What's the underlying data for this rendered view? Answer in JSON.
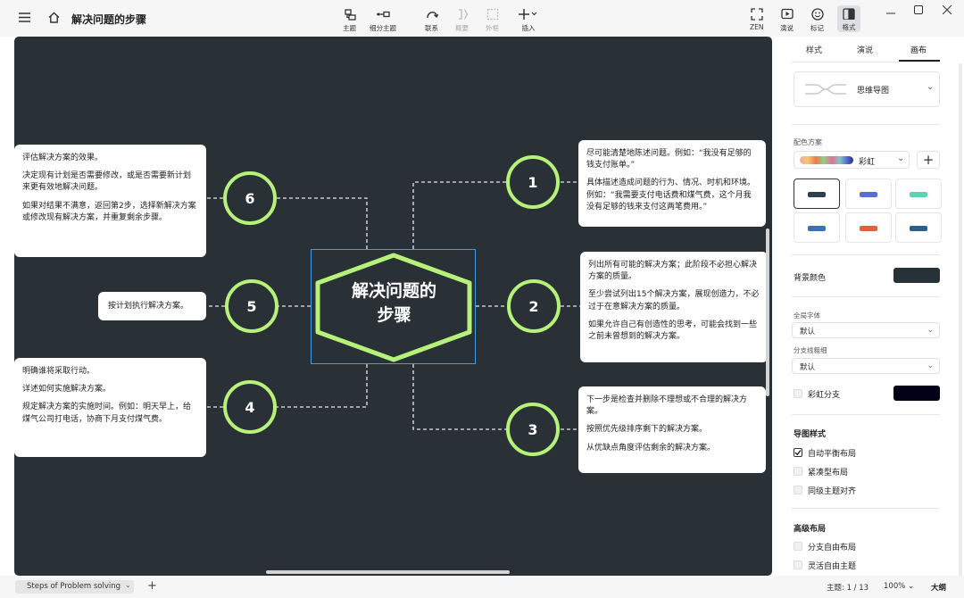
{
  "app": {
    "doc_title": "解决问题的步骤",
    "icons": [
      "menu-icon",
      "home-icon",
      "topic-icon",
      "subtopic-icon",
      "relationship-icon",
      "summary-icon",
      "boundary-icon",
      "insert-icon",
      "zen-icon",
      "present-icon",
      "marker-icon",
      "format-icon"
    ]
  },
  "toolbar": {
    "topic": "主题",
    "subtopic": "细分主题",
    "relationship": "联系",
    "summary": "概要",
    "boundary": "外框",
    "insert": "插入",
    "zen": "ZEN",
    "present": "演说",
    "marker": "标记",
    "format": "格式"
  },
  "map": {
    "central": [
      "解决问题的",
      "步骤"
    ],
    "numbers": [
      "1",
      "2",
      "3",
      "4",
      "5",
      "6"
    ],
    "notes": {
      "n1": [
        "尽可能清楚地陈述问题。例如：“我没有足够的钱支付账单。”",
        "具体描述造成问题的行为、情况、时机和环境。例如：“我需要支付电话费和煤气费，这个月我没有足够的钱来支付这两笔费用。”"
      ],
      "n2": [
        "列出所有可能的解决方案；此阶段不必担心解决方案的质量。",
        "至少尝试列出15个解决方案，展现创造力，不必过于在意解决方案的质量。",
        "如果允许自己有创造性的思考，可能会找到一些之前未曾想到的解决方案。"
      ],
      "n3": [
        "下一步是检查并删除不理想或不合理的解决方案。",
        "按照优先级排序剩下的解决方案。",
        "从优缺点角度评估剩余的解决方案。"
      ],
      "n4": [
        "明确谁将采取行动。",
        "详述如何实施解决方案。",
        "规定解决方案的实施时间。例如：明天早上，给煤气公司打电话，协商下月支付煤气费。"
      ],
      "n5": [
        "按计划执行解决方案。"
      ],
      "n6": [
        "评估解决方案的效果。",
        "决定现有计划是否需要修改，或是否需要新计划来更有效地解决问题。",
        "如果对结果不满意，返回第2步，选择新解决方案或修改现有解决方案，并重复剩余步骤。"
      ]
    }
  },
  "panel": {
    "tabs": [
      "样式",
      "演说",
      "画布"
    ],
    "structure": "思维导图",
    "color_scheme_label": "配色方案",
    "color_scheme_value": "彩虹",
    "add": "+",
    "bg_color_label": "背景颜色",
    "bg_color": "#273238",
    "global_font_label": "全局字体",
    "global_font_value": "默认",
    "branch_width_label": "分支线粗细",
    "branch_width_value": "默认",
    "rainbow_branch_label": "彩虹分支",
    "rainbow_color": "#020217",
    "map_style_title": "导图样式",
    "auto_balance": "自动平衡布局",
    "compact": "紧凑型布局",
    "align_same_level": "同级主题对齐",
    "advanced_title": "高级布局",
    "free_branch": "分支自由布局",
    "free_topic": "灵活自由主题"
  },
  "status": {
    "sheet_tab": "Steps of Problem solving",
    "add_sheet": "+",
    "topic_count": "主题: 1 / 13",
    "zoom": "100%",
    "outline": "大纲"
  },
  "colors": {
    "canvas": "#2a3136",
    "accent_green": "#b6f279",
    "selection_blue": "#3d9de8"
  }
}
